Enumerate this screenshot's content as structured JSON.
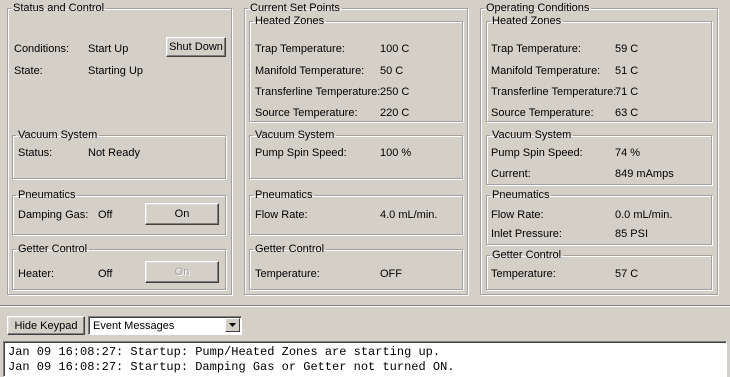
{
  "status_control": {
    "title": "Status and Control",
    "conditions_label": "Conditions:",
    "conditions_value": "Start Up",
    "shutdown_button": "Shut Down",
    "state_label": "State:",
    "state_value": "Starting Up",
    "vacuum": {
      "title": "Vacuum System",
      "status_label": "Status:",
      "status_value": "Not Ready"
    },
    "pneumatics": {
      "title": "Pneumatics",
      "damping_label": "Damping Gas:",
      "damping_value": "Off",
      "on_button": "On"
    },
    "getter": {
      "title": "Getter Control",
      "heater_label": "Heater:",
      "heater_value": "Off",
      "on_button": "On"
    }
  },
  "set_points": {
    "title": "Current Set Points",
    "heated_zones": {
      "title": "Heated Zones",
      "rows": [
        {
          "label": "Trap Temperature:",
          "value": "100 C"
        },
        {
          "label": "Manifold Temperature:",
          "value": "50 C"
        },
        {
          "label": "Transferline Temperature:",
          "value": "250 C"
        },
        {
          "label": "Source Temperature:",
          "value": "220 C"
        }
      ]
    },
    "vacuum": {
      "title": "Vacuum System",
      "label": "Pump Spin Speed:",
      "value": "100 %"
    },
    "pneumatics": {
      "title": "Pneumatics",
      "label": "Flow Rate:",
      "value": "4.0 mL/min."
    },
    "getter": {
      "title": "Getter Control",
      "label": "Temperature:",
      "value": "OFF"
    }
  },
  "operating": {
    "title": "Operating Conditions",
    "heated_zones": {
      "title": "Heated Zones",
      "rows": [
        {
          "label": "Trap Temperature:",
          "value": "59 C"
        },
        {
          "label": "Manifold Temperature:",
          "value": "51 C"
        },
        {
          "label": "Transferline Temperature:",
          "value": "71 C"
        },
        {
          "label": "Source Temperature:",
          "value": "63 C"
        }
      ]
    },
    "vacuum": {
      "title": "Vacuum System",
      "rows": [
        {
          "label": "Pump Spin Speed:",
          "value": "74 %"
        },
        {
          "label": "Current:",
          "value": "849 mAmps"
        }
      ]
    },
    "pneumatics": {
      "title": "Pneumatics",
      "rows": [
        {
          "label": "Flow Rate:",
          "value": "0.0 mL/min."
        },
        {
          "label": "Inlet Pressure:",
          "value": "85 PSI"
        }
      ]
    },
    "getter": {
      "title": "Getter Control",
      "label": "Temperature:",
      "value": "57 C"
    }
  },
  "toolbar": {
    "hide_keypad": "Hide Keypad",
    "messages_select": "Event Messages"
  },
  "log": {
    "lines": [
      "Jan 09 16:08:27: Startup: Pump/Heated Zones are starting up.",
      "Jan 09 16:08:27: Startup: Damping Gas or Getter not turned ON."
    ]
  }
}
